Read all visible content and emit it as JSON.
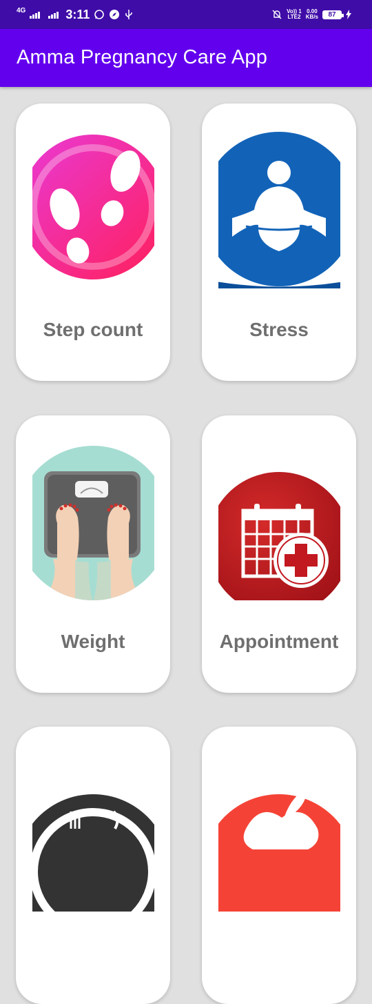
{
  "status_bar": {
    "network": "4G",
    "time": "3:11",
    "volte": "Vo)) 1\nLTE2",
    "speed": "0.00\nKB/s",
    "battery": "87"
  },
  "app_bar": {
    "title": "Amma Pregnancy Care App"
  },
  "cards": [
    {
      "label": "Step count",
      "icon": "footsteps-icon"
    },
    {
      "label": "Stress",
      "icon": "meditation-icon"
    },
    {
      "label": "Weight",
      "icon": "weighing-scale-icon"
    },
    {
      "label": "Appointment",
      "icon": "medical-calendar-icon"
    },
    {
      "label": "",
      "icon": "diet-plate-icon"
    },
    {
      "label": "",
      "icon": "apple-icon"
    }
  ],
  "colors": {
    "status_bar": "#3f0ca8",
    "app_bar": "#6200ee",
    "background": "#e0e0e0",
    "label": "#6f6f6f"
  }
}
